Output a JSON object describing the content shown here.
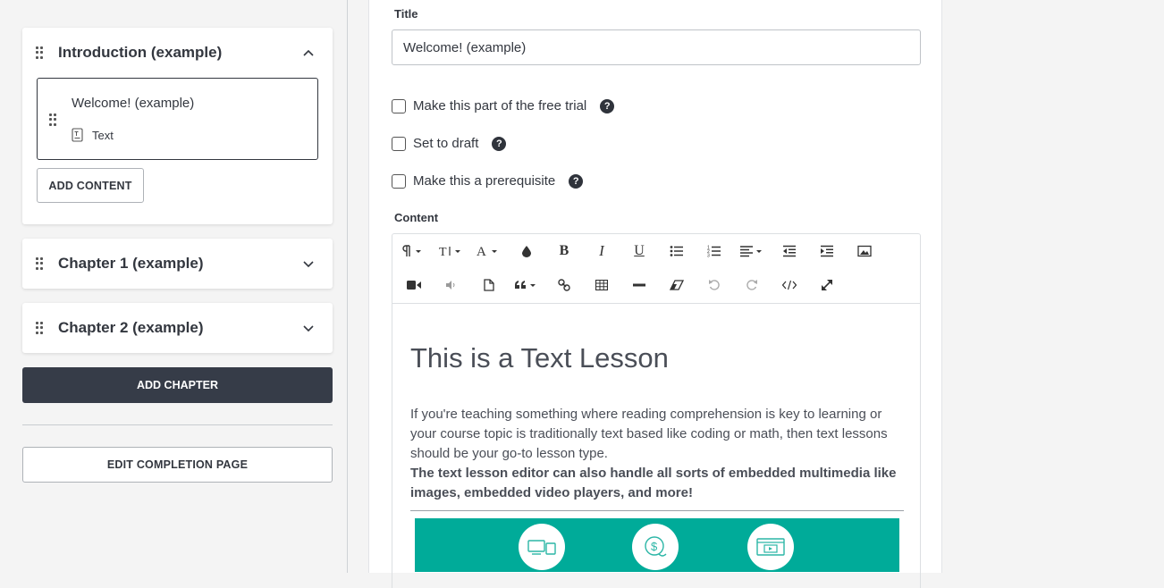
{
  "sidebar": {
    "chapters": [
      {
        "title": "Introduction (example)",
        "expanded": true,
        "contents": [
          {
            "title": "Welcome! (example)",
            "type": "Text"
          }
        ],
        "add_content_label": "ADD CONTENT"
      },
      {
        "title": "Chapter 1 (example)",
        "expanded": false
      },
      {
        "title": "Chapter 2 (example)",
        "expanded": false
      }
    ],
    "add_chapter_label": "ADD CHAPTER",
    "edit_completion_label": "EDIT COMPLETION PAGE"
  },
  "form": {
    "title_label": "Title",
    "title_value": "Welcome! (example)",
    "options": [
      {
        "label": "Make this part of the free trial",
        "checked": false
      },
      {
        "label": "Set to draft",
        "checked": false
      },
      {
        "label": "Make this a prerequisite",
        "checked": false
      }
    ],
    "help_glyph": "?",
    "content_label": "Content"
  },
  "editor": {
    "toolbar_icons": [
      "paragraph-icon",
      "font-size-icon",
      "font-family-icon",
      "color-icon",
      "bold-icon",
      "italic-icon",
      "underline-icon",
      "bullet-list-icon",
      "numbered-list-icon",
      "align-icon",
      "outdent-icon",
      "indent-icon",
      "image-icon",
      "video-icon",
      "audio-icon",
      "file-icon",
      "quote-icon",
      "link-icon",
      "table-icon",
      "horizontal-rule-icon",
      "eraser-icon",
      "undo-icon",
      "redo-icon",
      "code-icon",
      "fullscreen-icon"
    ],
    "heading": "This is a Text Lesson",
    "paragraph": "If you're teaching something where reading comprehension is key to learning or your course topic is traditionally text based like coding or math, then text lessons should be your go-to lesson type.",
    "bold_paragraph": "The text lesson editor can also handle all sorts of embedded multimedia like images, embedded video players, and more!",
    "banner_color": "#00ab99"
  },
  "colors": {
    "dark_button": "#363c48",
    "accent": "#00ab99"
  }
}
